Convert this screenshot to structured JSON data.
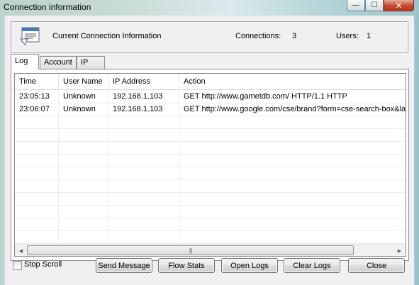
{
  "window": {
    "title": "Connection information",
    "controls": {
      "minimize": "—",
      "maximize": "☐",
      "close": "✕"
    }
  },
  "header": {
    "icon": "connection-info-icon",
    "title": "Current Connection Information",
    "connections_label": "Connections:",
    "connections_value": "3",
    "users_label": "Users:",
    "users_value": "1"
  },
  "tabs": [
    {
      "label": "Log",
      "active": true
    },
    {
      "label": "Account",
      "active": false
    },
    {
      "label": "IP",
      "active": false
    }
  ],
  "log_table": {
    "columns": [
      "Time",
      "User Name",
      "IP Address",
      "Action"
    ],
    "rows": [
      [
        "23:05:13",
        "Unknown",
        "192.168.1.103",
        "GET http://www.gametdb.com/ HTTP/1.1 HTTP"
      ],
      [
        "23:06:07",
        "Unknown",
        "192.168.1.103",
        "GET http://www.google.com/cse/brand?form=cse-search-box&lang=en"
      ]
    ],
    "scrollbar_grip": "|||"
  },
  "footer": {
    "stop_scroll_label": "Stop Scroll",
    "stop_scroll_checked": false,
    "buttons": {
      "send_message": "Send Message",
      "flow_stats": "Flow Stats",
      "open_logs": "Open Logs",
      "clear_logs": "Clear Logs",
      "close": "Close"
    }
  }
}
